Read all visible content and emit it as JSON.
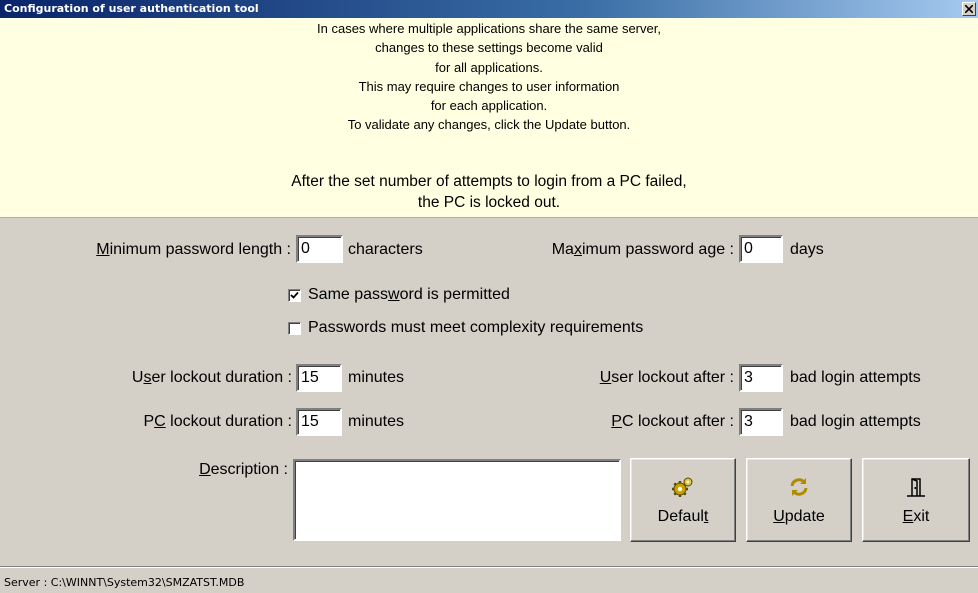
{
  "window": {
    "title": "Configuration of user authentication tool"
  },
  "info": {
    "lines": [
      "In cases where multiple applications share the same server,",
      "changes to these settings become valid",
      "for all applications.",
      "This may require changes to user information",
      "for each application.",
      "To validate any changes, click the Update button."
    ],
    "lockout_lines": [
      "After the set number of attempts to login from a PC failed,",
      "the PC is locked out."
    ]
  },
  "form": {
    "min_len_label": {
      "pre": "",
      "key": "M",
      "post": "inimum password length :"
    },
    "min_len_value": "0",
    "min_len_unit": "characters",
    "max_age_label": {
      "pre": "Ma",
      "key": "x",
      "post": "imum password age :"
    },
    "max_age_value": "0",
    "max_age_unit": "days",
    "same_pw": {
      "pre": "Same pass",
      "key": "w",
      "post": "ord is permitted",
      "checked": true
    },
    "complexity": {
      "label": "Passwords must meet complexity requirements",
      "checked": false
    },
    "user_lockout_dur_label": {
      "pre": "U",
      "key": "s",
      "post": "er lockout duration :"
    },
    "user_lockout_dur_value": "15",
    "user_lockout_dur_unit": "minutes",
    "user_lockout_after_label": {
      "pre": "",
      "key": "U",
      "post": "ser lockout after :"
    },
    "user_lockout_after_value": "3",
    "user_lockout_after_unit": "bad login attempts",
    "pc_lockout_dur_label": {
      "pre": "P",
      "key": "C",
      "post": " lockout duration :"
    },
    "pc_lockout_dur_value": "15",
    "pc_lockout_dur_unit": "minutes",
    "pc_lockout_after_label": {
      "pre": "",
      "key": "P",
      "post": "C lockout after :"
    },
    "pc_lockout_after_value": "3",
    "pc_lockout_after_unit": "bad login attempts",
    "description_label": {
      "pre": "",
      "key": "D",
      "post": "escription :"
    },
    "description_value": ""
  },
  "buttons": {
    "default": {
      "pre": "Defaul",
      "key": "t",
      "post": ""
    },
    "update": {
      "pre": "",
      "key": "U",
      "post": "pdate"
    },
    "exit": {
      "pre": "",
      "key": "E",
      "post": "xit"
    }
  },
  "status": {
    "text": "Server : C:\\WINNT\\System32\\SMZATST.MDB"
  },
  "colors": {
    "title_bar": "#0a246a",
    "banner": "#ffffe1",
    "face": "#d4d0c8"
  }
}
